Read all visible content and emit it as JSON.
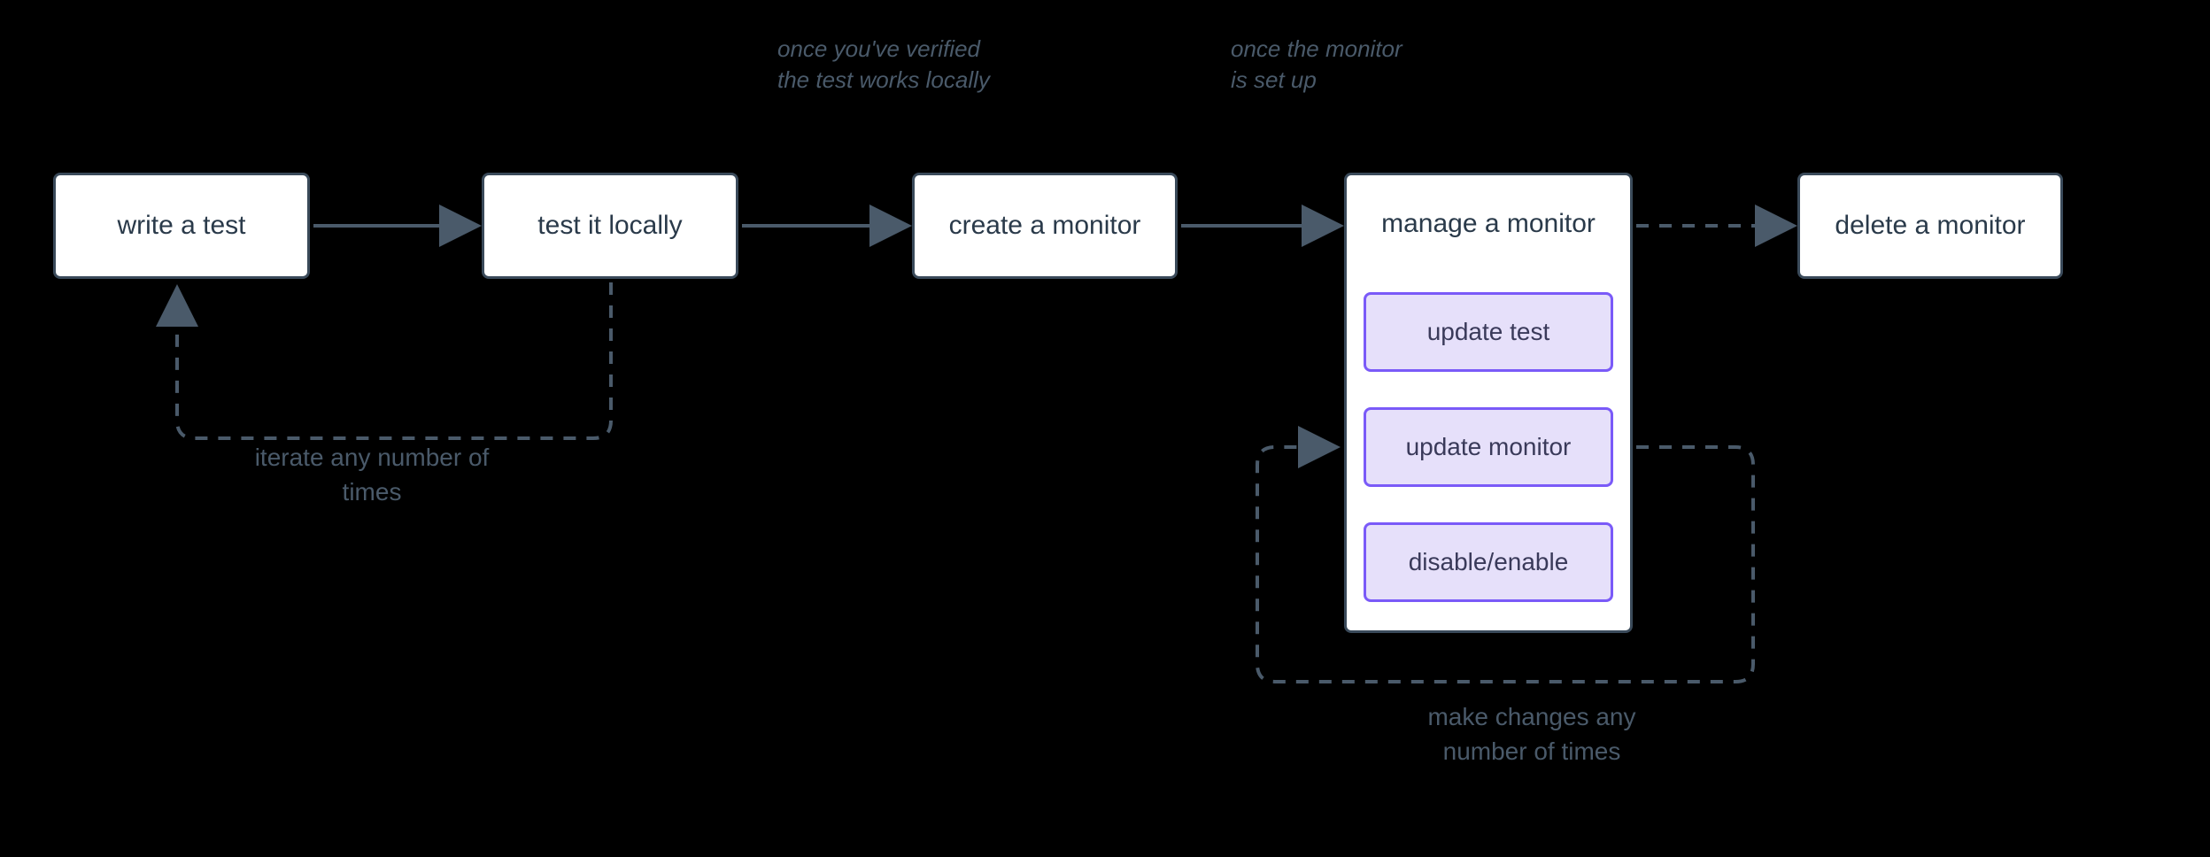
{
  "steps": {
    "write_test": "write a test",
    "test_locally": "test it locally",
    "create_monitor": "create a monitor",
    "manage_monitor": "manage a monitor",
    "delete_monitor": "delete a monitor"
  },
  "subactions": {
    "update_test": "update test",
    "update_monitor": "update monitor",
    "disable_enable": "disable/enable"
  },
  "notes": {
    "after_local": "once you've verified the test works locally",
    "after_setup": "once the monitor is set up"
  },
  "loop_labels": {
    "iterate": "iterate any number of times",
    "make_changes": "make changes any number of times"
  }
}
